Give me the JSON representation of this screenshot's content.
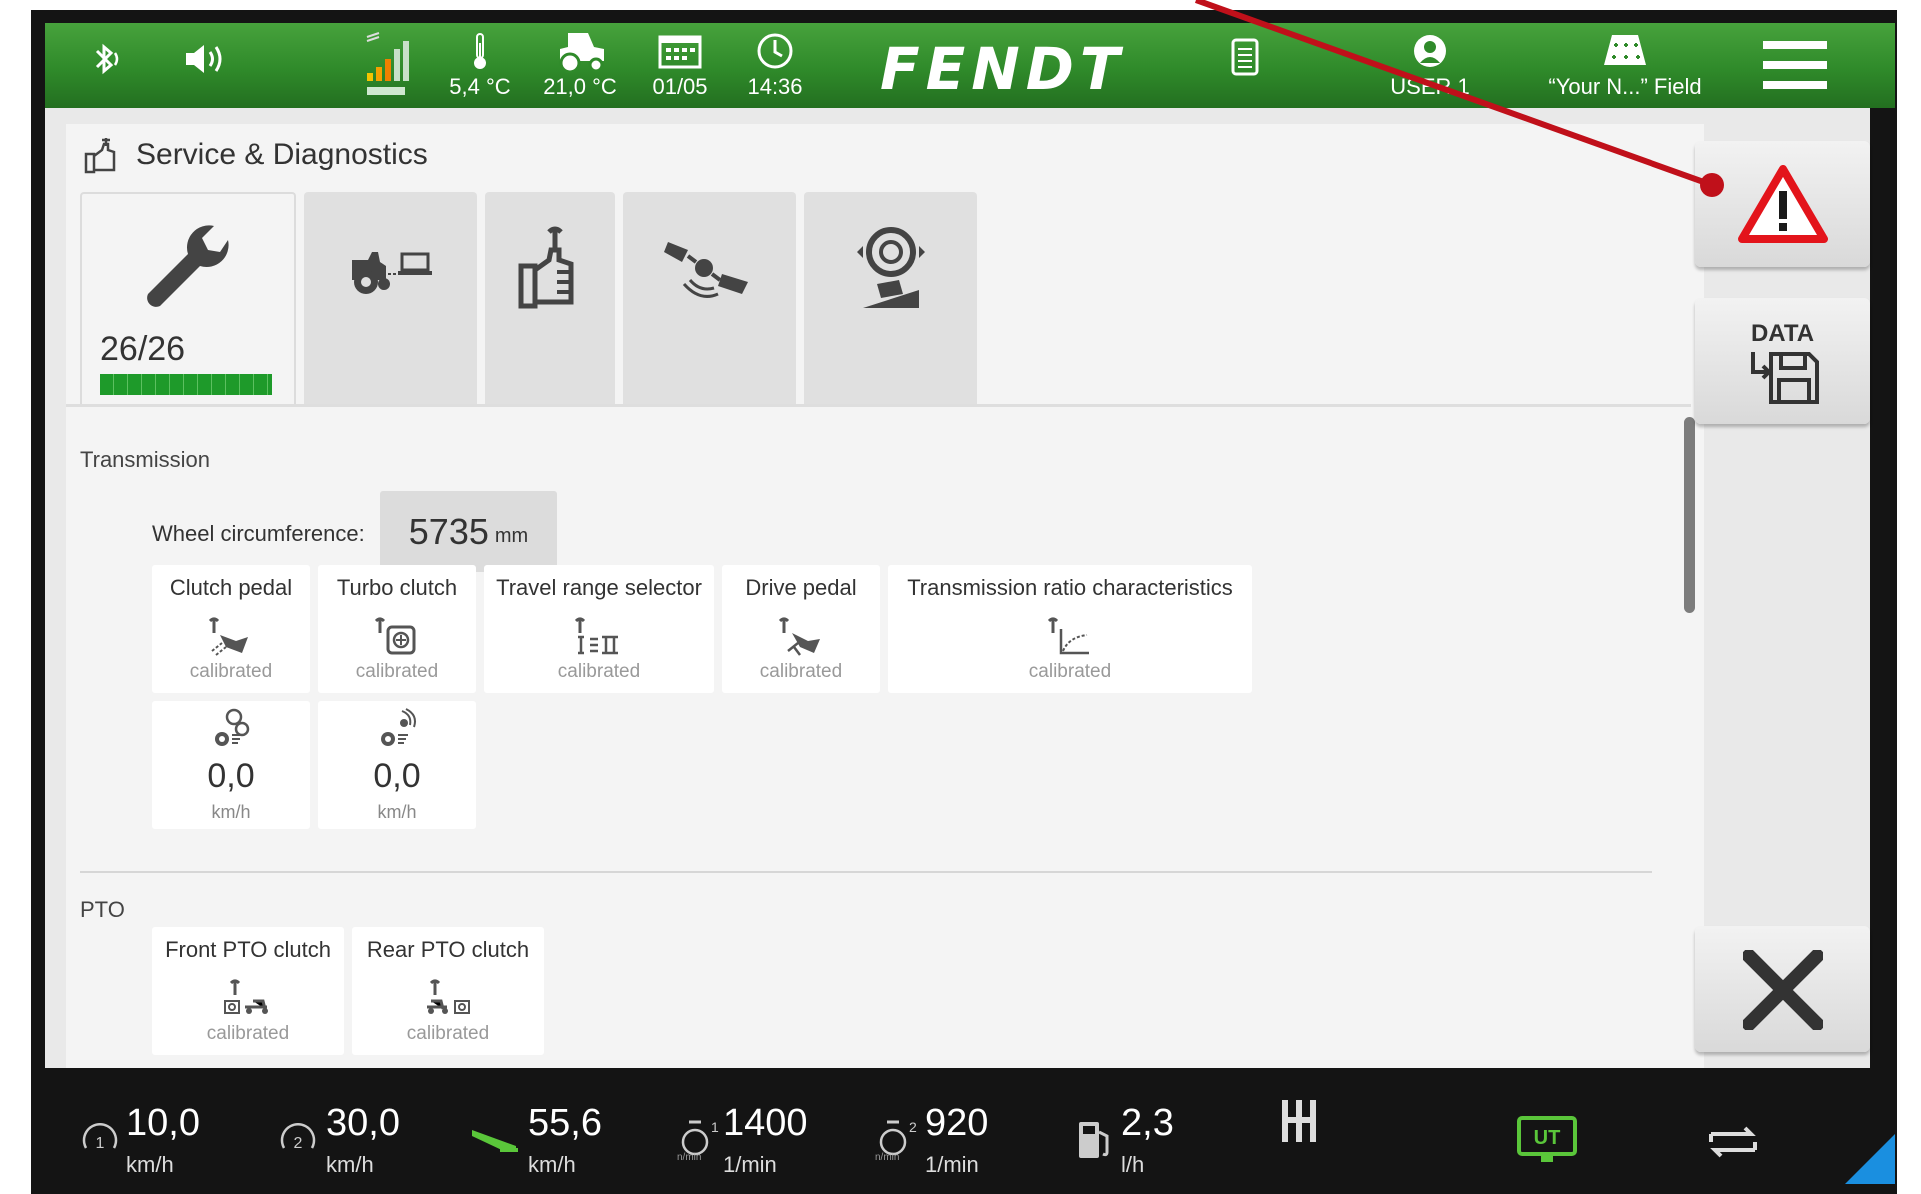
{
  "colors": {
    "topbar_green": "#2f8a2a",
    "progress_green": "#1e9a2a",
    "warning_red": "#e3141b",
    "arrow_red": "#c0101a",
    "ut_green": "#5ac63a",
    "accent_blue": "#1a8fe0"
  },
  "topbar": {
    "bluetooth_icon": "bluetooth-icon",
    "volume_icon": "volume-icon",
    "signal_icon": "signal-icon",
    "outside_temp": "5,4 °C",
    "oil_temp": "21,0 °C",
    "date": "01/05",
    "time": "14:36",
    "logo": "FENDT",
    "user": "USER 1",
    "field": "“Your N...” Field"
  },
  "panel": {
    "title": "Service & Diagnostics",
    "tabs": [
      {
        "icon": "wrench-icon",
        "count": "26/26",
        "progress": 1.0
      },
      {
        "icon": "tractor-laptop-icon"
      },
      {
        "icon": "hand-wrench-icon"
      },
      {
        "icon": "satellite-icon"
      },
      {
        "icon": "tire-pressure-icon"
      }
    ]
  },
  "transmission": {
    "section": "Transmission",
    "wheel_label": "Wheel circumference:",
    "wheel_value": "5735",
    "wheel_unit": "mm",
    "cards": [
      {
        "title": "Clutch pedal",
        "status": "calibrated"
      },
      {
        "title": "Turbo clutch",
        "status": "calibrated"
      },
      {
        "title": "Travel range selector",
        "status": "calibrated"
      },
      {
        "title": "Drive pedal",
        "status": "calibrated"
      },
      {
        "title": "Transmission ratio characteristics",
        "status": "calibrated"
      }
    ],
    "speeds": [
      {
        "value": "0,0",
        "unit": "km/h"
      },
      {
        "value": "0,0",
        "unit": "km/h"
      }
    ]
  },
  "pto": {
    "section": "PTO",
    "cards": [
      {
        "title": "Front PTO clutch",
        "status": "calibrated"
      },
      {
        "title": "Rear PTO clutch",
        "status": "calibrated"
      }
    ]
  },
  "side": {
    "data_label": "DATA"
  },
  "bottombar": {
    "speed1": {
      "value": "10,0",
      "unit": "km/h"
    },
    "speed2": {
      "value": "30,0",
      "unit": "km/h"
    },
    "speed3": {
      "value": "55,6",
      "unit": "km/h"
    },
    "pto1": {
      "value": "1400",
      "unit": "1/min",
      "sub": "n/min"
    },
    "pto2": {
      "value": "920",
      "unit": "1/min",
      "sub": "n/min"
    },
    "fuel": {
      "value": "2,3",
      "unit": "l/h"
    },
    "ut_label": "UT"
  }
}
